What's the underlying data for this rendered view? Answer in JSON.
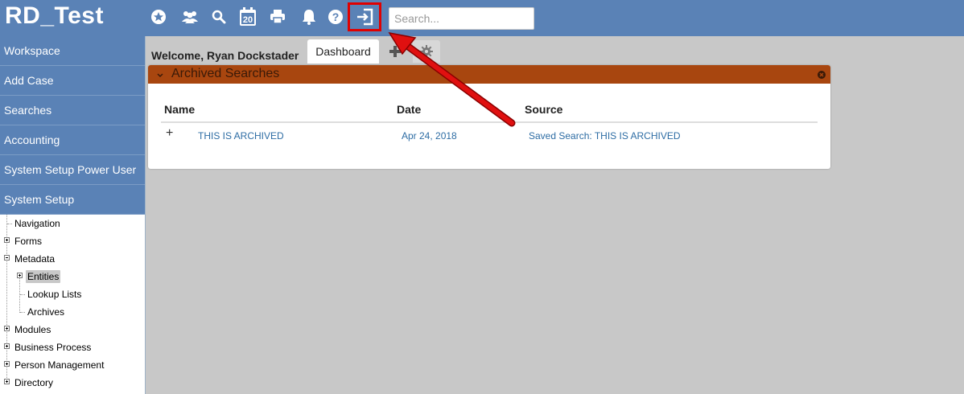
{
  "app": {
    "title": "RD_Test"
  },
  "toolbar": {
    "icons": [
      "favorites-icon",
      "users-icon",
      "search-icon",
      "calendar-icon",
      "print-icon",
      "bell-icon",
      "help-icon",
      "archive-exit-icon"
    ],
    "calendar_day": "20",
    "search_placeholder": "Search..."
  },
  "sidebar": {
    "items": [
      {
        "label": "Workspace"
      },
      {
        "label": "Add Case"
      },
      {
        "label": "Searches"
      },
      {
        "label": "Accounting"
      },
      {
        "label": "System Setup Power User"
      },
      {
        "label": "System Setup"
      }
    ],
    "tree": [
      {
        "label": "Navigation"
      },
      {
        "label": "Forms"
      },
      {
        "label": "Metadata"
      },
      {
        "label": "Entities"
      },
      {
        "label": "Lookup Lists"
      },
      {
        "label": "Archives"
      },
      {
        "label": "Modules"
      },
      {
        "label": "Business Process"
      },
      {
        "label": "Person Management"
      },
      {
        "label": "Directory"
      }
    ]
  },
  "main": {
    "welcome": "Welcome, Ryan Dockstader",
    "tabs": [
      {
        "label": "Dashboard"
      }
    ],
    "panel": {
      "title": "Archived Searches",
      "columns": [
        "Name",
        "Date",
        "Source"
      ],
      "rows": [
        {
          "expander": "+",
          "name": "THIS IS ARCHIVED",
          "date": "Apr 24, 2018",
          "source": "Saved Search: THIS IS ARCHIVED"
        }
      ]
    }
  },
  "colors": {
    "topbar": "#5a82b6",
    "panel_header": "#a8460f",
    "highlight": "#e00000",
    "link": "#2e6da4"
  }
}
